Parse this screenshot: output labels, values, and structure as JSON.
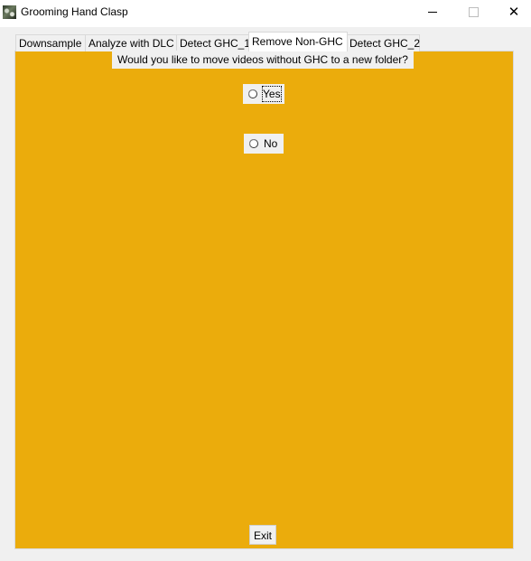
{
  "window": {
    "title": "Grooming Hand Clasp",
    "controls": {
      "minimize": "minimize-icon",
      "maximize": "maximize-icon",
      "close": "✕"
    }
  },
  "tabs": [
    {
      "label": "Downsample",
      "active": false
    },
    {
      "label": "Analyze with DLC",
      "active": false
    },
    {
      "label": "Detect GHC_1",
      "active": false
    },
    {
      "label": "Remove Non-GHC",
      "active": true
    },
    {
      "label": "Detect GHC_2",
      "active": false
    }
  ],
  "panel": {
    "background": "#ebac0c",
    "question": "Would you like to move videos without GHC to a new folder?",
    "options": [
      {
        "label": "Yes",
        "selected": false,
        "focused": true
      },
      {
        "label": "No",
        "selected": false,
        "focused": false
      }
    ],
    "exit_label": "Exit"
  }
}
